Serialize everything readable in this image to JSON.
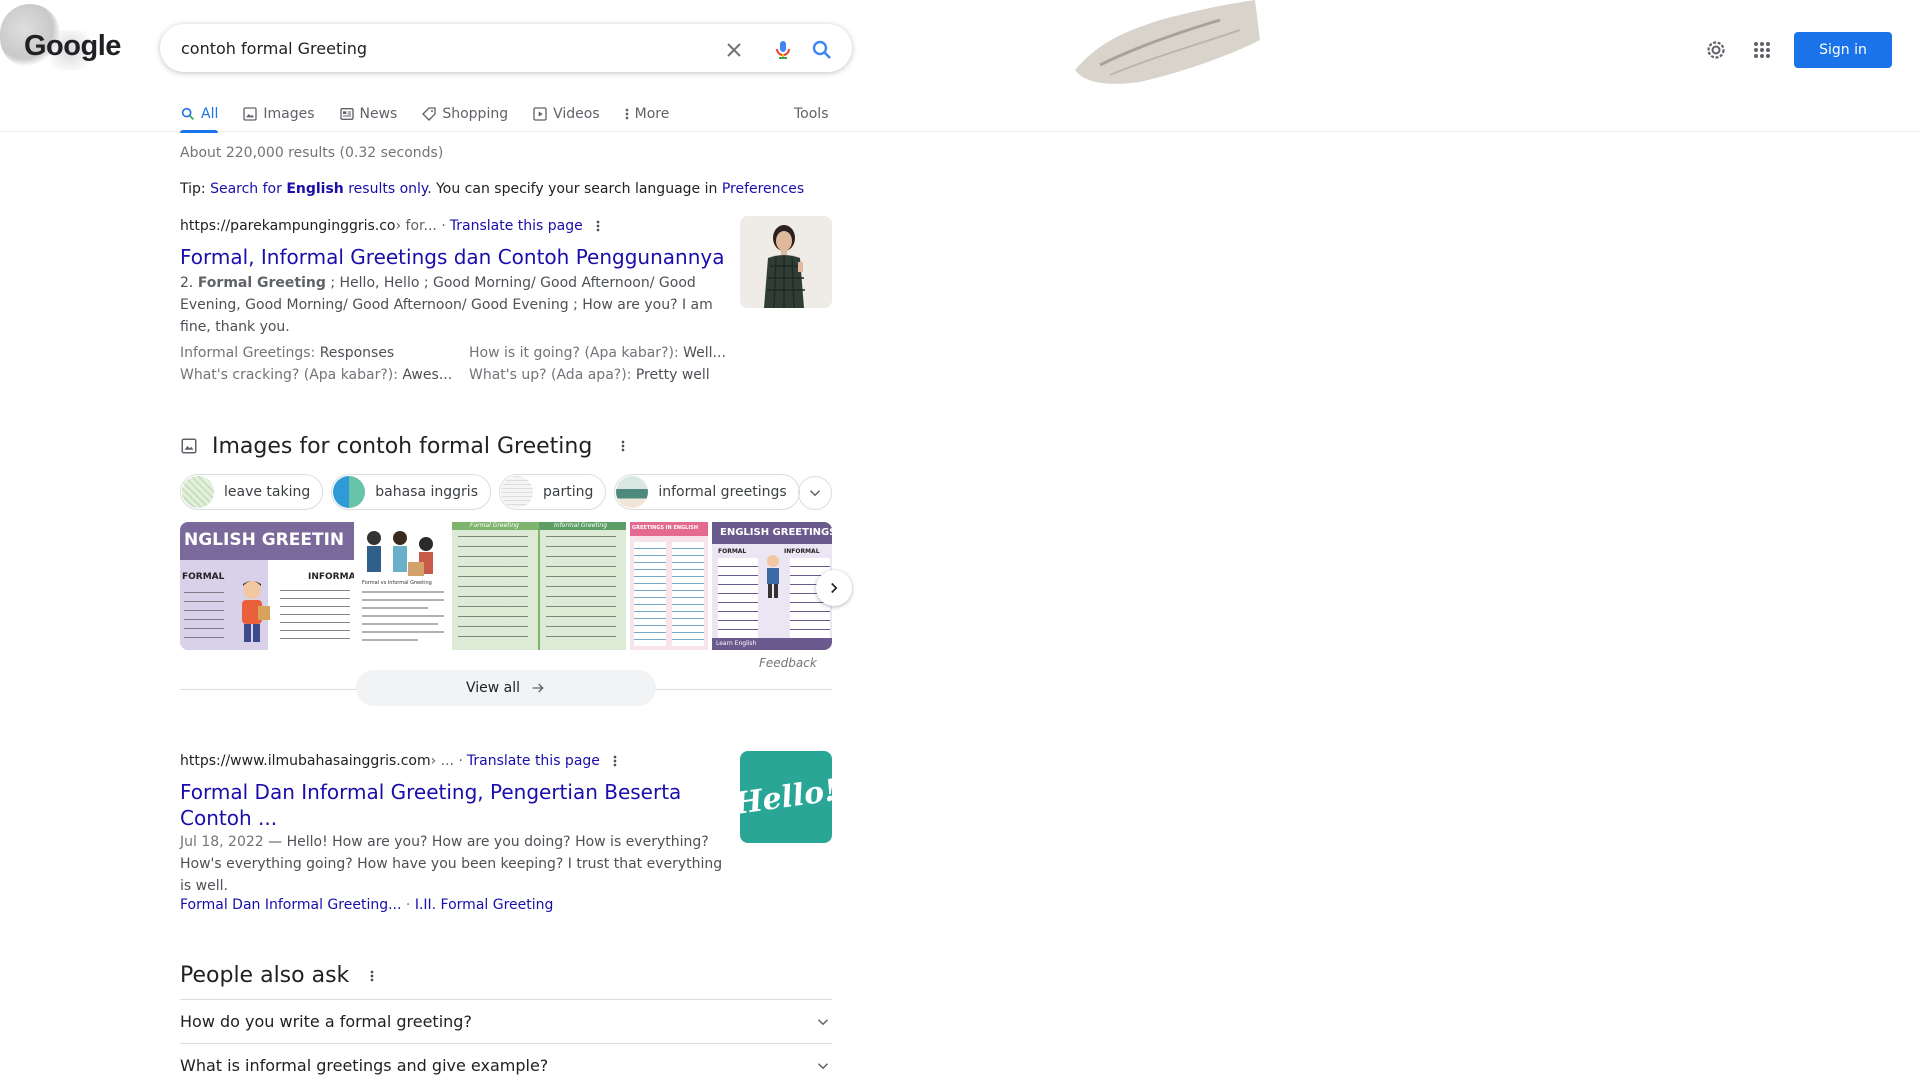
{
  "header": {
    "logo_text": "Google",
    "search_value": "contoh formal Greeting",
    "signin_label": "Sign in"
  },
  "tabs": [
    {
      "label": "All",
      "icon": "search-icon",
      "active": true
    },
    {
      "label": "Images",
      "icon": "image-icon"
    },
    {
      "label": "News",
      "icon": "news-icon"
    },
    {
      "label": "Shopping",
      "icon": "tag-icon"
    },
    {
      "label": "Videos",
      "icon": "play-icon"
    },
    {
      "label": "More",
      "icon": "more-vert-icon"
    }
  ],
  "tools_label": "Tools",
  "stats": "About 220,000 results (0.32 seconds)",
  "tip": {
    "prefix": "Tip: ",
    "link1": "Search for ",
    "link_bold": "English",
    "link2": " results only",
    "middle": ". You can specify your search language in ",
    "pref": "Preferences"
  },
  "result1": {
    "url": "https://parekampunginggris.co",
    "path": " › for... · ",
    "translate": "Translate this page",
    "title": "Formal, Informal Greetings dan Contoh Penggunannya",
    "snippet_pre": "2. ",
    "snippet_bold": "Formal Greeting",
    "snippet_rest": " ; Hello, Hello ; Good Morning/ Good Afternoon/ Good Evening, Good Morning/ Good Afternoon/ Good Evening ; How are you? I am fine, thank you.",
    "sub": [
      {
        "k": "Informal Greetings: ",
        "v": "Responses"
      },
      {
        "k": "How is it going? (Apa kabar?): ",
        "v": "Well..."
      },
      {
        "k": "What's cracking? (Apa kabar?): ",
        "v": "Awes..."
      },
      {
        "k": "What's up? (Ada apa?): ",
        "v": "Pretty well"
      }
    ]
  },
  "images_block": {
    "title": "Images for contoh formal Greeting",
    "chips": [
      "leave taking",
      "bahasa inggris",
      "parting",
      "informal greetings"
    ],
    "strip": [
      {
        "label": "NGLISH GREETIN",
        "sub1": "FORMAL",
        "sub2": "INFORMAL"
      },
      {
        "label": "Formal vs Informal Greeting"
      },
      {
        "label": "Formal Greeting",
        "label2": "Informal Greeting"
      },
      {
        "label": "GREETINGS IN ENGLISH"
      },
      {
        "label": "ENGLISH GREETINGS",
        "sub1": "FORMAL",
        "sub2": "INFORMAL",
        "foot": "Learn English"
      }
    ],
    "feedback": "Feedback",
    "view_all": "View all"
  },
  "result2": {
    "url": "https://www.ilmubahasainggris.com",
    "path": " › ... · ",
    "translate": "Translate this page",
    "title": "Formal Dan Informal Greeting, Pengertian Beserta Contoh ...",
    "date": "Jul 18, 2022",
    "snippet": " — Hello! How are you? How are you doing? How is everything? How's everything going? How have you been keeping? I trust that everything is well.",
    "sitelink1": "Formal Dan Informal Greeting...",
    "sitelink_sep": " · ",
    "sitelink2": "I.II. Formal Greeting",
    "thumb_text": "Hello!"
  },
  "paa": {
    "title": "People also ask",
    "questions": [
      "How do you write a formal greeting?",
      "What is informal greetings and give example?"
    ]
  },
  "colors": {
    "link": "#1a0dab",
    "accent": "#1a73e8"
  }
}
